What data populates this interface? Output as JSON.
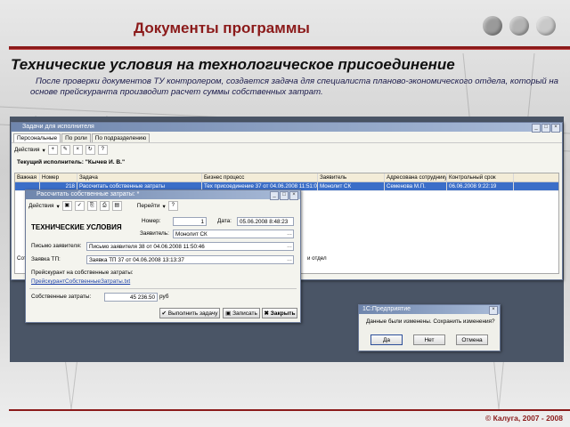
{
  "slide": {
    "title": "Документы программы",
    "heading": "Технические условия на технологическое присоединение",
    "description": "После проверки документов ТУ контролером, создается задача для специалиста планово-экономического отдела, который на основе прейскуранта производит расчет суммы собственных затрат.",
    "copyright": "© Калуга, 2007 - 2008",
    "accent_color": "#8b1a1a"
  },
  "tasks_window": {
    "title": "Задачи для исполнителя",
    "tabs": [
      "Персональные",
      "По роли",
      "По подразделению"
    ],
    "toolbar_actions": "Действия",
    "executor_label": "Текущий исполнитель: \"Кычев И. В.\"",
    "columns": [
      "Важная",
      "Номер",
      "Задача",
      "Бизнес процесс",
      "Заявитель",
      "Адресована сотруднику",
      "Контрольный срок"
    ],
    "rows": [
      {
        "important": "",
        "number": "218",
        "task": "Рассчитать собственные затраты",
        "process": "Тех присоединение 37 от 04.06.2008 11:51:06",
        "applicant": "Монолит СК",
        "employee": "Семенова М.П.",
        "deadline": "06.06.2008 9:22:19"
      }
    ],
    "bottom_row": {
      "left": "Сотр",
      "right": "и отдел"
    }
  },
  "cost_window": {
    "title": "Рассчитать собственные затраты: *",
    "toolbar_actions": "Действия",
    "toolbar_goto": "Перейти",
    "doc_title": "ТЕХНИЧЕСКИЕ УСЛОВИЯ",
    "number_label": "Номер:",
    "number_value": "1",
    "date_label": "Дата:",
    "date_value": "05.06.2008 8:48:23",
    "applicant_label": "Заявитель:",
    "applicant_value": "Монолит СК",
    "letter_label": "Письмо заявителя:",
    "letter_value": "Письмо заявителя 38 от 04.06.2008 11:50:46",
    "request_label": "Заявка ТП:",
    "request_value": "Заявка ТП 37 от 04.06.2008 13:13:37",
    "pricelist_label": "Прейскурант на собственные затраты:",
    "pricelist_link": "ПрейскурантСобственныеЗатраты.txt",
    "costs_label": "Собственные затраты:",
    "costs_value": "45 236.50",
    "costs_unit": "руб",
    "btn_execute": "Выполнить задачу",
    "btn_save": "Записать",
    "btn_close": "Закрыть"
  },
  "dialog": {
    "title": "1С:Предприятие",
    "message": "Данные были изменены. Сохранить изменения?",
    "btn_yes": "Да",
    "btn_no": "Нет",
    "btn_cancel": "Отмена"
  }
}
